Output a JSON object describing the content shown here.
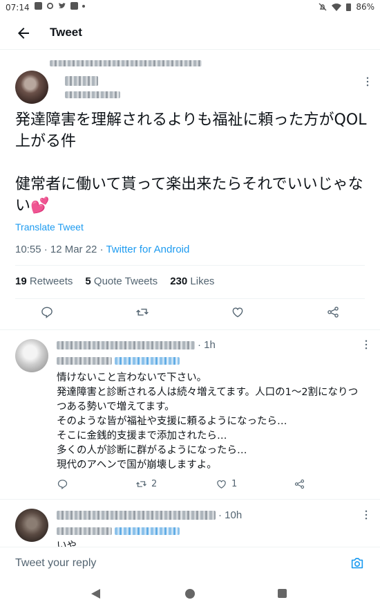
{
  "status": {
    "time": "07:14",
    "battery": "86%"
  },
  "header": {
    "title": "Tweet"
  },
  "main_tweet": {
    "text": "発達障害を理解されるよりも福祉に頼った方がQOL上がる件\n\n健常者に働いて貰って楽出来たらそれでいいじゃない💕",
    "translate_label": "Translate Tweet",
    "time": "10:55 · 12 Mar 22 · ",
    "client": "Twitter for Android",
    "stats": {
      "retweets_count": "19",
      "retweets_label": "Retweets",
      "quotes_count": "5",
      "quotes_label": "Quote Tweets",
      "likes_count": "230",
      "likes_label": "Likes"
    }
  },
  "replies": [
    {
      "time": "· 1h",
      "text": "情けないこと言わないで下さい。\n発達障害と診断される人は続々増えてます。人口の1〜2割になりつつある勢いで増えてます。\nそのような皆が福祉や支援に頼るようになったら…\nそこに金銭的支援まで添加されたら…\n多くの人が診断に群がるようになったら…\n現代のアヘンで国が崩壊しますよ。",
      "retweets": "2",
      "likes": "1"
    },
    {
      "time": "· 10h",
      "text": "いや"
    }
  ],
  "composer": {
    "placeholder": "Tweet your reply"
  },
  "icons": [
    "back-arrow-icon",
    "more-icon",
    "reply-icon",
    "retweet-icon",
    "like-icon",
    "share-icon",
    "camera-icon"
  ],
  "colors": {
    "accent": "#1d9bf0",
    "text": "#0f1419",
    "muted": "#536471"
  }
}
